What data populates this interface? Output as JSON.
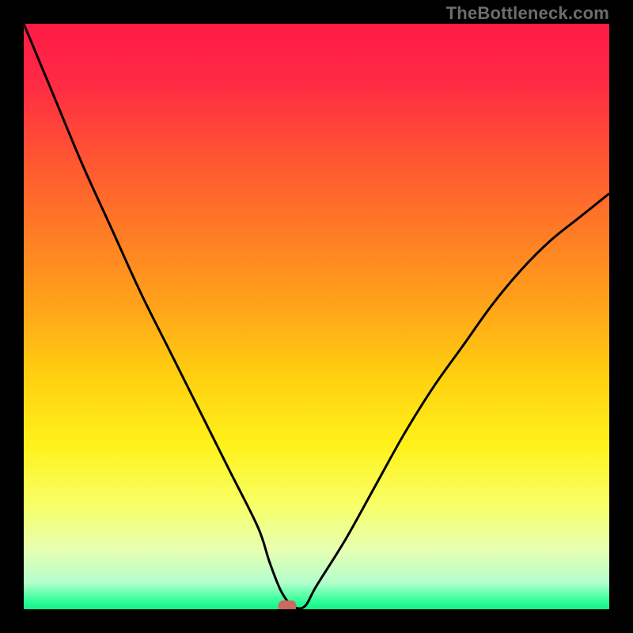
{
  "watermark": "TheBottleneck.com",
  "colors": {
    "frame": "#000000",
    "gradient_stops": [
      {
        "offset": 0.0,
        "color": "#ff1a47"
      },
      {
        "offset": 0.1,
        "color": "#ff2a44"
      },
      {
        "offset": 0.22,
        "color": "#ff5233"
      },
      {
        "offset": 0.35,
        "color": "#ff7a26"
      },
      {
        "offset": 0.48,
        "color": "#ffa31a"
      },
      {
        "offset": 0.6,
        "color": "#ffcf0f"
      },
      {
        "offset": 0.72,
        "color": "#fff21a"
      },
      {
        "offset": 0.82,
        "color": "#f8ff66"
      },
      {
        "offset": 0.9,
        "color": "#e6ffb3"
      },
      {
        "offset": 0.955,
        "color": "#b3ffcc"
      },
      {
        "offset": 0.985,
        "color": "#33ff99"
      },
      {
        "offset": 1.0,
        "color": "#13f08a"
      }
    ],
    "curve": "#000000",
    "marker_fill": "#c96a60",
    "marker_stroke": "#c96a60"
  },
  "chart_data": {
    "type": "line",
    "title": "",
    "xlabel": "",
    "ylabel": "",
    "xlim": [
      0,
      100
    ],
    "ylim": [
      0,
      100
    ],
    "grid": false,
    "legend": false,
    "series": [
      {
        "name": "bottleneck-curve",
        "x": [
          0,
          5,
          10,
          15,
          20,
          25,
          30,
          35,
          40,
          42,
          44,
          46,
          48,
          50,
          55,
          60,
          65,
          70,
          75,
          80,
          85,
          90,
          95,
          100
        ],
        "y": [
          100,
          88,
          76,
          65,
          54,
          44,
          34,
          24,
          14,
          8,
          3,
          0.5,
          0.5,
          4,
          12,
          21,
          30,
          38,
          45,
          52,
          58,
          63,
          67,
          71
        ]
      }
    ],
    "marker": {
      "x": 45,
      "y": 0.5
    }
  }
}
